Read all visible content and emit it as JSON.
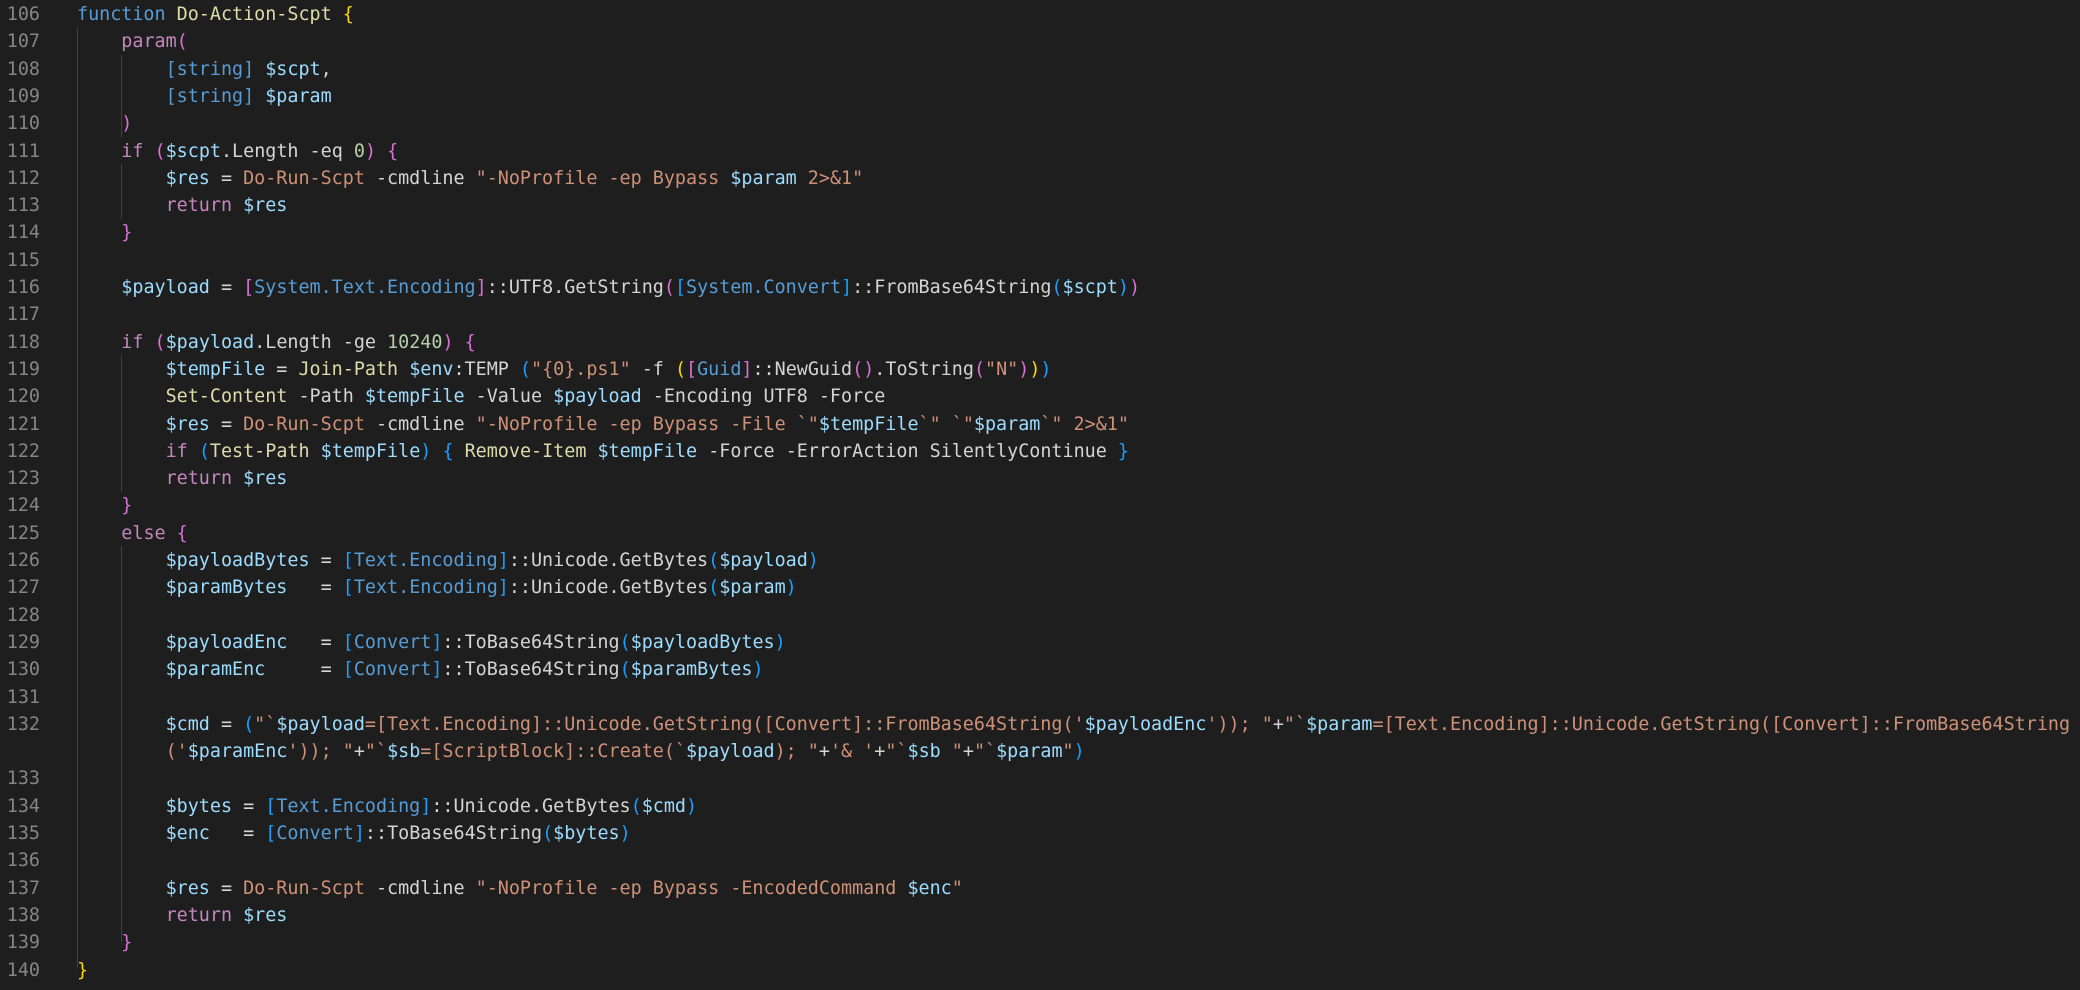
{
  "editor": {
    "language": "powershell",
    "colors": {
      "background": "#1e1e1e",
      "line_number": "#858585",
      "keyword": "#c586c0",
      "function_keyword": "#569cd6",
      "function_name": "#dcdcaa",
      "variable": "#9cdcfe",
      "string": "#ce9178",
      "number": "#b5cea8",
      "type": "#569cd6",
      "bracket_level_1": "#ffd700",
      "bracket_level_2": "#da70d6",
      "bracket_level_3": "#179fff"
    },
    "lines": [
      {
        "n": "106",
        "tokens": [
          [
            "fk",
            "function"
          ],
          [
            "op",
            " "
          ],
          [
            "fn",
            "Do-Action-Scpt"
          ],
          [
            "op",
            " "
          ],
          [
            "br1",
            "{"
          ]
        ]
      },
      {
        "n": "107",
        "tokens": [
          [
            "op",
            "    "
          ],
          [
            "kw",
            "param"
          ],
          [
            "br2",
            "("
          ]
        ]
      },
      {
        "n": "108",
        "tokens": [
          [
            "op",
            "        "
          ],
          [
            "typeb",
            "[string]"
          ],
          [
            "op",
            " "
          ],
          [
            "var",
            "$scpt"
          ],
          [
            "op",
            ","
          ]
        ]
      },
      {
        "n": "109",
        "tokens": [
          [
            "op",
            "        "
          ],
          [
            "typeb",
            "[string]"
          ],
          [
            "op",
            " "
          ],
          [
            "var",
            "$param"
          ]
        ]
      },
      {
        "n": "110",
        "tokens": [
          [
            "op",
            "    "
          ],
          [
            "br2",
            ")"
          ]
        ]
      },
      {
        "n": "111",
        "tokens": [
          [
            "op",
            "    "
          ],
          [
            "kw",
            "if"
          ],
          [
            "op",
            " "
          ],
          [
            "br2",
            "("
          ],
          [
            "var",
            "$scpt"
          ],
          [
            "op",
            ".Length -eq "
          ],
          [
            "num",
            "0"
          ],
          [
            "br2",
            ")"
          ],
          [
            "op",
            " "
          ],
          [
            "br2",
            "{"
          ]
        ]
      },
      {
        "n": "112",
        "tokens": [
          [
            "op",
            "        "
          ],
          [
            "var",
            "$res"
          ],
          [
            "op",
            " = "
          ],
          [
            "str",
            "Do-Run-Scpt"
          ],
          [
            "op",
            " -cmdline "
          ],
          [
            "str",
            "\"-NoProfile -ep Bypass "
          ],
          [
            "var",
            "$param"
          ],
          [
            "str",
            " 2>&1\""
          ]
        ]
      },
      {
        "n": "113",
        "tokens": [
          [
            "op",
            "        "
          ],
          [
            "kw",
            "return"
          ],
          [
            "op",
            " "
          ],
          [
            "var",
            "$res"
          ]
        ]
      },
      {
        "n": "114",
        "tokens": [
          [
            "op",
            "    "
          ],
          [
            "br2",
            "}"
          ]
        ]
      },
      {
        "n": "115",
        "tokens": []
      },
      {
        "n": "116",
        "tokens": [
          [
            "op",
            "    "
          ],
          [
            "var",
            "$payload"
          ],
          [
            "op",
            " = "
          ],
          [
            "br2",
            "["
          ],
          [
            "typeb",
            "System.Text.Encoding"
          ],
          [
            "br2",
            "]"
          ],
          [
            "op",
            "::UTF8.GetString"
          ],
          [
            "br2",
            "("
          ],
          [
            "br3",
            "["
          ],
          [
            "typeb",
            "System.Convert"
          ],
          [
            "br3",
            "]"
          ],
          [
            "op",
            "::FromBase64String"
          ],
          [
            "br3",
            "("
          ],
          [
            "var",
            "$scpt"
          ],
          [
            "br3",
            ")"
          ],
          [
            "br2",
            ")"
          ]
        ]
      },
      {
        "n": "117",
        "tokens": []
      },
      {
        "n": "118",
        "tokens": [
          [
            "op",
            "    "
          ],
          [
            "kw",
            "if"
          ],
          [
            "op",
            " "
          ],
          [
            "br2",
            "("
          ],
          [
            "var",
            "$payload"
          ],
          [
            "op",
            ".Length -ge "
          ],
          [
            "num",
            "10240"
          ],
          [
            "br2",
            ")"
          ],
          [
            "op",
            " "
          ],
          [
            "br2",
            "{"
          ]
        ]
      },
      {
        "n": "119",
        "tokens": [
          [
            "op",
            "        "
          ],
          [
            "var",
            "$tempFile"
          ],
          [
            "op",
            " = "
          ],
          [
            "fn",
            "Join-Path"
          ],
          [
            "op",
            " "
          ],
          [
            "var",
            "$env"
          ],
          [
            "op",
            ":TEMP "
          ],
          [
            "br3",
            "("
          ],
          [
            "str",
            "\"{0}.ps1\""
          ],
          [
            "op",
            " -f "
          ],
          [
            "br1",
            "("
          ],
          [
            "br2",
            "["
          ],
          [
            "typeb",
            "Guid"
          ],
          [
            "br2",
            "]"
          ],
          [
            "op",
            "::NewGuid"
          ],
          [
            "br2",
            "()"
          ],
          [
            "op",
            ".ToString"
          ],
          [
            "br2",
            "("
          ],
          [
            "str",
            "\"N\""
          ],
          [
            "br2",
            ")"
          ],
          [
            "br1",
            ")"
          ],
          [
            "br3",
            ")"
          ]
        ]
      },
      {
        "n": "120",
        "tokens": [
          [
            "op",
            "        "
          ],
          [
            "fn",
            "Set-Content"
          ],
          [
            "op",
            " -Path "
          ],
          [
            "var",
            "$tempFile"
          ],
          [
            "op",
            " -Value "
          ],
          [
            "var",
            "$payload"
          ],
          [
            "op",
            " -Encoding UTF8 -Force"
          ]
        ]
      },
      {
        "n": "121",
        "tokens": [
          [
            "op",
            "        "
          ],
          [
            "var",
            "$res"
          ],
          [
            "op",
            " = "
          ],
          [
            "str",
            "Do-Run-Scpt"
          ],
          [
            "op",
            " -cmdline "
          ],
          [
            "str",
            "\"-NoProfile -ep Bypass -File `\""
          ],
          [
            "var",
            "$tempFile"
          ],
          [
            "str",
            "`\" `\""
          ],
          [
            "var",
            "$param"
          ],
          [
            "str",
            "`\" 2>&1\""
          ]
        ]
      },
      {
        "n": "122",
        "tokens": [
          [
            "op",
            "        "
          ],
          [
            "kw",
            "if"
          ],
          [
            "op",
            " "
          ],
          [
            "br3",
            "("
          ],
          [
            "fn",
            "Test-Path"
          ],
          [
            "op",
            " "
          ],
          [
            "var",
            "$tempFile"
          ],
          [
            "br3",
            ")"
          ],
          [
            "op",
            " "
          ],
          [
            "br3",
            "{"
          ],
          [
            "op",
            " "
          ],
          [
            "fn",
            "Remove-Item"
          ],
          [
            "op",
            " "
          ],
          [
            "var",
            "$tempFile"
          ],
          [
            "op",
            " -Force -ErrorAction SilentlyContinue "
          ],
          [
            "br3",
            "}"
          ]
        ]
      },
      {
        "n": "123",
        "tokens": [
          [
            "op",
            "        "
          ],
          [
            "kw",
            "return"
          ],
          [
            "op",
            " "
          ],
          [
            "var",
            "$res"
          ]
        ]
      },
      {
        "n": "124",
        "tokens": [
          [
            "op",
            "    "
          ],
          [
            "br2",
            "}"
          ]
        ]
      },
      {
        "n": "125",
        "tokens": [
          [
            "op",
            "    "
          ],
          [
            "kw",
            "else"
          ],
          [
            "op",
            " "
          ],
          [
            "br2",
            "{"
          ]
        ]
      },
      {
        "n": "126",
        "tokens": [
          [
            "op",
            "        "
          ],
          [
            "var",
            "$payloadBytes"
          ],
          [
            "op",
            " = "
          ],
          [
            "br3",
            "["
          ],
          [
            "typeb",
            "Text.Encoding"
          ],
          [
            "br3",
            "]"
          ],
          [
            "op",
            "::Unicode.GetBytes"
          ],
          [
            "br3",
            "("
          ],
          [
            "var",
            "$payload"
          ],
          [
            "br3",
            ")"
          ]
        ]
      },
      {
        "n": "127",
        "tokens": [
          [
            "op",
            "        "
          ],
          [
            "var",
            "$paramBytes"
          ],
          [
            "op",
            "   = "
          ],
          [
            "br3",
            "["
          ],
          [
            "typeb",
            "Text.Encoding"
          ],
          [
            "br3",
            "]"
          ],
          [
            "op",
            "::Unicode.GetBytes"
          ],
          [
            "br3",
            "("
          ],
          [
            "var",
            "$param"
          ],
          [
            "br3",
            ")"
          ]
        ]
      },
      {
        "n": "128",
        "tokens": []
      },
      {
        "n": "129",
        "tokens": [
          [
            "op",
            "        "
          ],
          [
            "var",
            "$payloadEnc"
          ],
          [
            "op",
            "   = "
          ],
          [
            "br3",
            "["
          ],
          [
            "typeb",
            "Convert"
          ],
          [
            "br3",
            "]"
          ],
          [
            "op",
            "::ToBase64String"
          ],
          [
            "br3",
            "("
          ],
          [
            "var",
            "$payloadBytes"
          ],
          [
            "br3",
            ")"
          ]
        ]
      },
      {
        "n": "130",
        "tokens": [
          [
            "op",
            "        "
          ],
          [
            "var",
            "$paramEnc"
          ],
          [
            "op",
            "     = "
          ],
          [
            "br3",
            "["
          ],
          [
            "typeb",
            "Convert"
          ],
          [
            "br3",
            "]"
          ],
          [
            "op",
            "::ToBase64String"
          ],
          [
            "br3",
            "("
          ],
          [
            "var",
            "$paramBytes"
          ],
          [
            "br3",
            ")"
          ]
        ]
      },
      {
        "n": "131",
        "tokens": []
      },
      {
        "n": "132",
        "tokens": [
          [
            "op",
            "        "
          ],
          [
            "var",
            "$cmd"
          ],
          [
            "op",
            " = "
          ],
          [
            "br3",
            "("
          ],
          [
            "str",
            "\"`"
          ],
          [
            "var",
            "$payload"
          ],
          [
            "str",
            "=[Text.Encoding]::Unicode.GetString([Convert]::FromBase64String('"
          ],
          [
            "var",
            "$payloadEnc"
          ],
          [
            "str",
            "')); \""
          ],
          [
            "op",
            "+"
          ],
          [
            "str",
            "\"`"
          ],
          [
            "var",
            "$param"
          ],
          [
            "str",
            "=[Text.Encoding]::Unicode.GetString([Convert]::FromBase64String"
          ]
        ]
      },
      {
        "n": "",
        "tokens": [
          [
            "op",
            "        "
          ],
          [
            "str",
            "('"
          ],
          [
            "var",
            "$paramEnc"
          ],
          [
            "str",
            "')); \""
          ],
          [
            "op",
            "+"
          ],
          [
            "str",
            "\"`"
          ],
          [
            "var",
            "$sb"
          ],
          [
            "str",
            "=[ScriptBlock]::Create(`"
          ],
          [
            "var",
            "$payload"
          ],
          [
            "str",
            "); \""
          ],
          [
            "op",
            "+"
          ],
          [
            "str",
            "'& '"
          ],
          [
            "op",
            "+"
          ],
          [
            "str",
            "\"`"
          ],
          [
            "var",
            "$sb"
          ],
          [
            "str",
            " \""
          ],
          [
            "op",
            "+"
          ],
          [
            "str",
            "\"`"
          ],
          [
            "var",
            "$param"
          ],
          [
            "str",
            "\""
          ],
          [
            "br3",
            ")"
          ]
        ]
      },
      {
        "n": "133",
        "tokens": []
      },
      {
        "n": "134",
        "tokens": [
          [
            "op",
            "        "
          ],
          [
            "var",
            "$bytes"
          ],
          [
            "op",
            " = "
          ],
          [
            "br3",
            "["
          ],
          [
            "typeb",
            "Text.Encoding"
          ],
          [
            "br3",
            "]"
          ],
          [
            "op",
            "::Unicode.GetBytes"
          ],
          [
            "br3",
            "("
          ],
          [
            "var",
            "$cmd"
          ],
          [
            "br3",
            ")"
          ]
        ]
      },
      {
        "n": "135",
        "tokens": [
          [
            "op",
            "        "
          ],
          [
            "var",
            "$enc"
          ],
          [
            "op",
            "   = "
          ],
          [
            "br3",
            "["
          ],
          [
            "typeb",
            "Convert"
          ],
          [
            "br3",
            "]"
          ],
          [
            "op",
            "::ToBase64String"
          ],
          [
            "br3",
            "("
          ],
          [
            "var",
            "$bytes"
          ],
          [
            "br3",
            ")"
          ]
        ]
      },
      {
        "n": "136",
        "tokens": []
      },
      {
        "n": "137",
        "tokens": [
          [
            "op",
            "        "
          ],
          [
            "var",
            "$res"
          ],
          [
            "op",
            " = "
          ],
          [
            "str",
            "Do-Run-Scpt"
          ],
          [
            "op",
            " -cmdline "
          ],
          [
            "str",
            "\"-NoProfile -ep Bypass -EncodedCommand "
          ],
          [
            "var",
            "$enc"
          ],
          [
            "str",
            "\""
          ]
        ]
      },
      {
        "n": "138",
        "tokens": [
          [
            "op",
            "        "
          ],
          [
            "kw",
            "return"
          ],
          [
            "op",
            " "
          ],
          [
            "var",
            "$res"
          ]
        ]
      },
      {
        "n": "139",
        "tokens": [
          [
            "op",
            "    "
          ],
          [
            "br2",
            "}"
          ]
        ]
      },
      {
        "n": "140",
        "tokens": [
          [
            "br1",
            "}"
          ]
        ]
      }
    ]
  }
}
